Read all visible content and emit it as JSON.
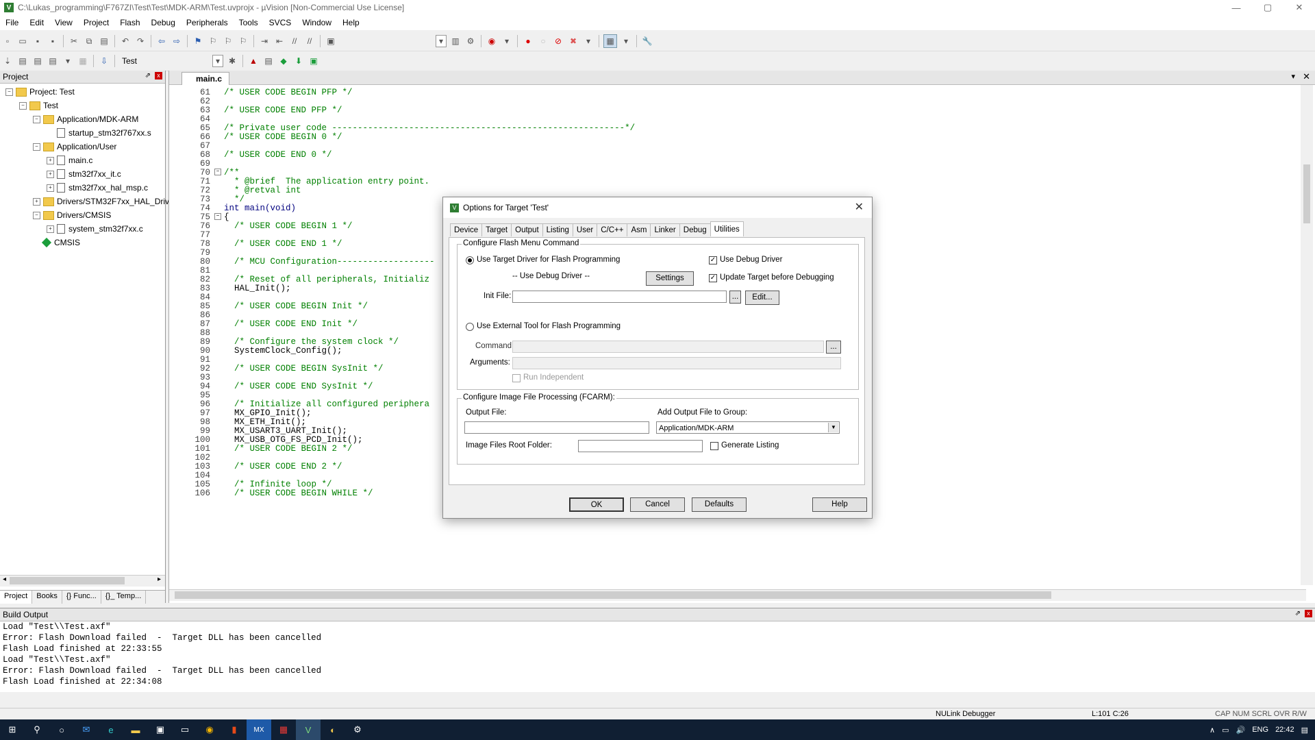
{
  "window": {
    "title": "C:\\Lukas_programming\\F767ZI\\Test\\Test\\MDK-ARM\\Test.uvprojx - µVision  [Non-Commercial Use License]",
    "app_icon": "V",
    "min": "—",
    "max": "▢",
    "close": "✕"
  },
  "menu": [
    "File",
    "Edit",
    "View",
    "Project",
    "Flash",
    "Debug",
    "Peripherals",
    "Tools",
    "SVCS",
    "Window",
    "Help"
  ],
  "toolbar2": {
    "target_name": "Test"
  },
  "project_panel": {
    "title": "Project",
    "pin": "⇗",
    "close": "x",
    "tree": [
      {
        "label": "Project: Test",
        "indent": 0,
        "exp": "−",
        "icon": "project"
      },
      {
        "label": "Test",
        "indent": 1,
        "exp": "−",
        "icon": "folder"
      },
      {
        "label": "Application/MDK-ARM",
        "indent": 2,
        "exp": "−",
        "icon": "folder"
      },
      {
        "label": "startup_stm32f767xx.s",
        "indent": 3,
        "exp": "",
        "icon": "file"
      },
      {
        "label": "Application/User",
        "indent": 2,
        "exp": "−",
        "icon": "folder"
      },
      {
        "label": "main.c",
        "indent": 3,
        "exp": "+",
        "icon": "file"
      },
      {
        "label": "stm32f7xx_it.c",
        "indent": 3,
        "exp": "+",
        "icon": "file"
      },
      {
        "label": "stm32f7xx_hal_msp.c",
        "indent": 3,
        "exp": "+",
        "icon": "file"
      },
      {
        "label": "Drivers/STM32F7xx_HAL_Driv",
        "indent": 2,
        "exp": "+",
        "icon": "folder"
      },
      {
        "label": "Drivers/CMSIS",
        "indent": 2,
        "exp": "−",
        "icon": "folder"
      },
      {
        "label": "system_stm32f7xx.c",
        "indent": 3,
        "exp": "+",
        "icon": "file"
      },
      {
        "label": "CMSIS",
        "indent": 2,
        "exp": "",
        "icon": "gem"
      }
    ],
    "tabs": [
      "Project",
      "Books",
      "{} Func...",
      "{}_ Temp..."
    ]
  },
  "editor": {
    "tab": "main.c",
    "lines": [
      {
        "n": "61",
        "t": "/* USER CODE BEGIN PFP */",
        "c": "cm"
      },
      {
        "n": "62",
        "t": "",
        "c": ""
      },
      {
        "n": "63",
        "t": "/* USER CODE END PFP */",
        "c": "cm"
      },
      {
        "n": "64",
        "t": "",
        "c": ""
      },
      {
        "n": "65",
        "t": "/* Private user code ---------------------------------------------------------*/",
        "c": "cm"
      },
      {
        "n": "66",
        "t": "/* USER CODE BEGIN 0 */",
        "c": "cm"
      },
      {
        "n": "67",
        "t": "",
        "c": ""
      },
      {
        "n": "68",
        "t": "/* USER CODE END 0 */",
        "c": "cm"
      },
      {
        "n": "69",
        "t": "",
        "c": ""
      },
      {
        "n": "70",
        "t": "/**",
        "c": "cm"
      },
      {
        "n": "71",
        "t": "  * @brief  The application entry point.",
        "c": "cm"
      },
      {
        "n": "72",
        "t": "  * @retval int",
        "c": "cm"
      },
      {
        "n": "73",
        "t": "  */",
        "c": "cm"
      },
      {
        "n": "74",
        "t": "int main(void)",
        "c": "kw"
      },
      {
        "n": "75",
        "t": "{",
        "c": ""
      },
      {
        "n": "76",
        "t": "  /* USER CODE BEGIN 1 */",
        "c": "cm"
      },
      {
        "n": "77",
        "t": "",
        "c": ""
      },
      {
        "n": "78",
        "t": "  /* USER CODE END 1 */",
        "c": "cm"
      },
      {
        "n": "79",
        "t": "",
        "c": ""
      },
      {
        "n": "80",
        "t": "  /* MCU Configuration-------------------",
        "c": "cm"
      },
      {
        "n": "81",
        "t": "",
        "c": ""
      },
      {
        "n": "82",
        "t": "  /* Reset of all peripherals, Initializ",
        "c": "cm"
      },
      {
        "n": "83",
        "t": "  HAL_Init();",
        "c": ""
      },
      {
        "n": "84",
        "t": "",
        "c": ""
      },
      {
        "n": "85",
        "t": "  /* USER CODE BEGIN Init */",
        "c": "cm"
      },
      {
        "n": "86",
        "t": "",
        "c": ""
      },
      {
        "n": "87",
        "t": "  /* USER CODE END Init */",
        "c": "cm"
      },
      {
        "n": "88",
        "t": "",
        "c": ""
      },
      {
        "n": "89",
        "t": "  /* Configure the system clock */",
        "c": "cm"
      },
      {
        "n": "90",
        "t": "  SystemClock_Config();",
        "c": ""
      },
      {
        "n": "91",
        "t": "",
        "c": ""
      },
      {
        "n": "92",
        "t": "  /* USER CODE BEGIN SysInit */",
        "c": "cm"
      },
      {
        "n": "93",
        "t": "",
        "c": ""
      },
      {
        "n": "94",
        "t": "  /* USER CODE END SysInit */",
        "c": "cm"
      },
      {
        "n": "95",
        "t": "",
        "c": ""
      },
      {
        "n": "96",
        "t": "  /* Initialize all configured periphera",
        "c": "cm"
      },
      {
        "n": "97",
        "t": "  MX_GPIO_Init();",
        "c": ""
      },
      {
        "n": "98",
        "t": "  MX_ETH_Init();",
        "c": ""
      },
      {
        "n": "99",
        "t": "  MX_USART3_UART_Init();",
        "c": ""
      },
      {
        "n": "100",
        "t": "  MX_USB_OTG_FS_PCD_Init();",
        "c": ""
      },
      {
        "n": "101",
        "t": "  /* USER CODE BEGIN 2 */",
        "c": "cm"
      },
      {
        "n": "102",
        "t": "",
        "c": ""
      },
      {
        "n": "103",
        "t": "  /* USER CODE END 2 */",
        "c": "cm"
      },
      {
        "n": "104",
        "t": "",
        "c": ""
      },
      {
        "n": "105",
        "t": "  /* Infinite loop */",
        "c": "cm"
      },
      {
        "n": "106",
        "t": "  /* USER CODE BEGIN WHILE */",
        "c": "cm"
      }
    ]
  },
  "output": {
    "title": "Build Output",
    "lines": [
      "Load \"Test\\\\Test.axf\"",
      "Error: Flash Download failed  -  Target DLL has been cancelled",
      "Flash Load finished at 22:33:55",
      "Load \"Test\\\\Test.axf\"",
      "Error: Flash Download failed  -  Target DLL has been cancelled",
      "Flash Load finished at 22:34:08"
    ]
  },
  "status": {
    "debugger": "NULink Debugger",
    "position": "L:101 C:26",
    "indicators": "CAP  NUM  SCRL  OVR  R/W"
  },
  "taskbar": {
    "time": "22:42",
    "lang": "ENG"
  },
  "dialog": {
    "title": "Options for Target 'Test'",
    "close": "✕",
    "tabs": [
      "Device",
      "Target",
      "Output",
      "Listing",
      "User",
      "C/C++",
      "Asm",
      "Linker",
      "Debug",
      "Utilities"
    ],
    "active_tab": "Utilities",
    "flash_group": "Configure Flash Menu Command",
    "use_target_driver": "Use Target Driver for Flash Programming",
    "use_debug_driver_chk": "Use Debug Driver",
    "use_debug_driver_label": "-- Use Debug Driver --",
    "settings_btn": "Settings",
    "update_target_chk": "Update Target before Debugging",
    "init_file_label": "Init File:",
    "init_file_value": "",
    "browse": "...",
    "edit_btn": "Edit...",
    "use_external_tool": "Use External Tool for Flash Programming",
    "command_label": "Command:",
    "arguments_label": "Arguments:",
    "run_independent": "Run Independent",
    "image_group": "Configure Image File Processing (FCARM):",
    "output_file_label": "Output File:",
    "add_output_label": "Add Output File  to Group:",
    "group_value": "Application/MDK-ARM",
    "root_folder_label": "Image Files Root Folder:",
    "generate_listing": "Generate Listing",
    "ok": "OK",
    "cancel": "Cancel",
    "defaults": "Defaults",
    "help": "Help"
  }
}
